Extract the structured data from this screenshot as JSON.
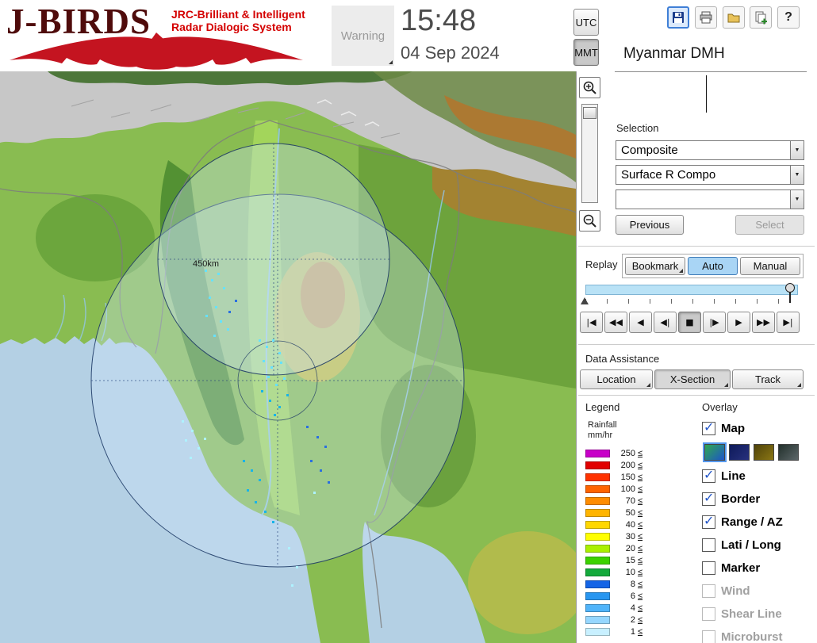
{
  "header": {
    "logo_title": "J-BIRDS",
    "logo_subtitle_1": "JRC-Brilliant & Intelligent",
    "logo_subtitle_2": "Radar  Dialogic  System",
    "warning_label": "Warning",
    "time": "15:48",
    "date": "04 Sep 2024",
    "utc_label": "UTC",
    "mmt_label": "MMT",
    "help_label": "?",
    "station_name": "Myanmar DMH"
  },
  "icons": {
    "toolbar": [
      "save-icon",
      "print-icon",
      "open-folder-icon",
      "new-window-icon",
      "help-icon"
    ],
    "map_zoom": [
      "zoom-in-icon",
      "zoom-out-icon"
    ]
  },
  "map": {
    "range_label": "450km"
  },
  "selection": {
    "label": "Selection",
    "dropdown_1": "Composite",
    "dropdown_2": "Surface R Compo",
    "dropdown_3": "",
    "previous_label": "Previous",
    "select_label": "Select"
  },
  "replay": {
    "label": "Replay",
    "bookmark_label": "Bookmark",
    "auto_label": "Auto",
    "manual_label": "Manual",
    "active_index": 4,
    "playback_buttons": [
      "|◀",
      "◀◀",
      "◀",
      "◀|",
      "■",
      "|▶",
      "▶",
      "▶▶",
      "▶|"
    ]
  },
  "data_assistance": {
    "label": "Data Assistance",
    "location_label": "Location",
    "xsection_label": "X-Section",
    "track_label": "Track"
  },
  "legend": {
    "title": "Legend",
    "unit_line_1": "Rainfall",
    "unit_line_2": "mm/hr",
    "suffix": "≤",
    "rows": [
      {
        "value": "250",
        "color": "#c800c8"
      },
      {
        "value": "200",
        "color": "#e10000"
      },
      {
        "value": "150",
        "color": "#ff3200"
      },
      {
        "value": "100",
        "color": "#ff6400"
      },
      {
        "value": "70",
        "color": "#ff8c00"
      },
      {
        "value": "50",
        "color": "#ffb400"
      },
      {
        "value": "40",
        "color": "#ffd700"
      },
      {
        "value": "30",
        "color": "#ffff00"
      },
      {
        "value": "20",
        "color": "#aaf000"
      },
      {
        "value": "15",
        "color": "#3cd200"
      },
      {
        "value": "10",
        "color": "#14aa3c"
      },
      {
        "value": "8",
        "color": "#1464e6"
      },
      {
        "value": "6",
        "color": "#2896f0"
      },
      {
        "value": "4",
        "color": "#50b4fa"
      },
      {
        "value": "2",
        "color": "#96d7ff"
      },
      {
        "value": "1",
        "color": "#c8f0ff"
      }
    ]
  },
  "overlay": {
    "title": "Overlay",
    "items": [
      {
        "label": "Map",
        "checked": true,
        "disabled": false
      },
      {
        "label": "Line",
        "checked": true,
        "disabled": false
      },
      {
        "label": "Border",
        "checked": true,
        "disabled": false
      },
      {
        "label": "Range / AZ",
        "checked": true,
        "disabled": false
      },
      {
        "label": "Lati / Long",
        "checked": false,
        "disabled": false
      },
      {
        "label": "Marker",
        "checked": false,
        "disabled": false
      },
      {
        "label": "Wind",
        "checked": false,
        "disabled": true
      },
      {
        "label": "Shear Line",
        "checked": false,
        "disabled": true
      },
      {
        "label": "Microburst",
        "checked": false,
        "disabled": true
      }
    ],
    "map_styles": [
      {
        "name": "terrain",
        "colors": [
          "#2fa84f",
          "#1d55c8"
        ],
        "selected": true
      },
      {
        "name": "navy",
        "colors": [
          "#0e1a5a",
          "#27317d"
        ],
        "selected": false
      },
      {
        "name": "olive",
        "colors": [
          "#4f430a",
          "#8a7614"
        ],
        "selected": false
      },
      {
        "name": "dark",
        "colors": [
          "#22302c",
          "#5c6668"
        ],
        "selected": false
      }
    ]
  }
}
